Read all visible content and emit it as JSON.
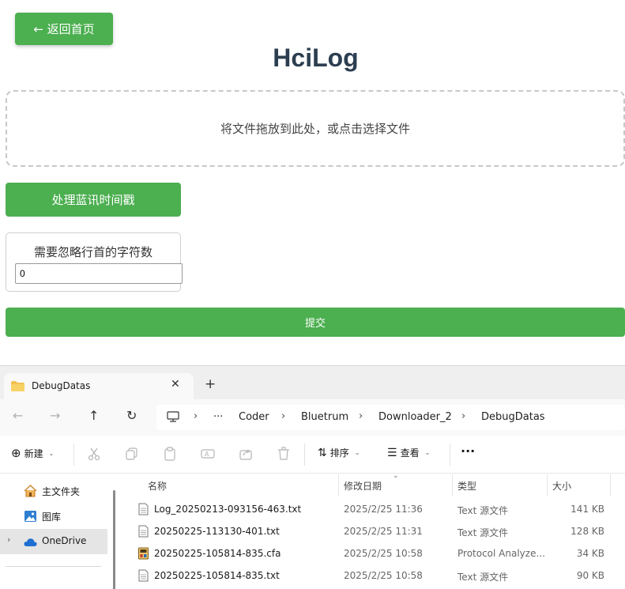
{
  "app": {
    "back_button": "← 返回首页",
    "title": "HciLog",
    "dropzone_text": "将文件拖放到此处，或点击选择文件",
    "process_button": "处理蓝讯时间戳",
    "ignore_label": "需要忽略行首的字符数",
    "ignore_value": "0",
    "submit_button": "提交",
    "accent_color": "#4caf50"
  },
  "explorer": {
    "tab_title": "DebugDatas",
    "close_glyph": "✕",
    "new_tab_glyph": "+",
    "breadcrumb": [
      "Coder",
      "Bluetrum",
      "Downloader_2",
      "DebugDatas"
    ],
    "crumb_more": "···",
    "crumb_sep": "›",
    "toolbar": {
      "new_label": "新建",
      "sort_label": "排序",
      "view_label": "查看",
      "more_label": "···"
    },
    "sidebar": [
      {
        "label": "主文件夹",
        "icon": "home-icon"
      },
      {
        "label": "图库",
        "icon": "gallery-icon"
      },
      {
        "label": "OneDrive",
        "icon": "cloud-icon",
        "selected": true
      }
    ],
    "columns": {
      "name": "名称",
      "date": "修改日期",
      "type": "类型",
      "size": "大小"
    },
    "files": [
      {
        "name": "Log_20250213-093156-463.txt",
        "date": "2025/2/25 11:36",
        "type": "Text 源文件",
        "size": "141 KB",
        "icon": "text-file-icon"
      },
      {
        "name": "20250225-113130-401.txt",
        "date": "2025/2/25 11:31",
        "type": "Text 源文件",
        "size": "128 KB",
        "icon": "text-file-icon"
      },
      {
        "name": "20250225-105814-835.cfa",
        "date": "2025/2/25 10:58",
        "type": "Protocol Analyze...",
        "size": "34 KB",
        "icon": "cfa-file-icon"
      },
      {
        "name": "20250225-105814-835.txt",
        "date": "2025/2/25 10:58",
        "type": "Text 源文件",
        "size": "90 KB",
        "icon": "text-file-icon"
      }
    ]
  }
}
